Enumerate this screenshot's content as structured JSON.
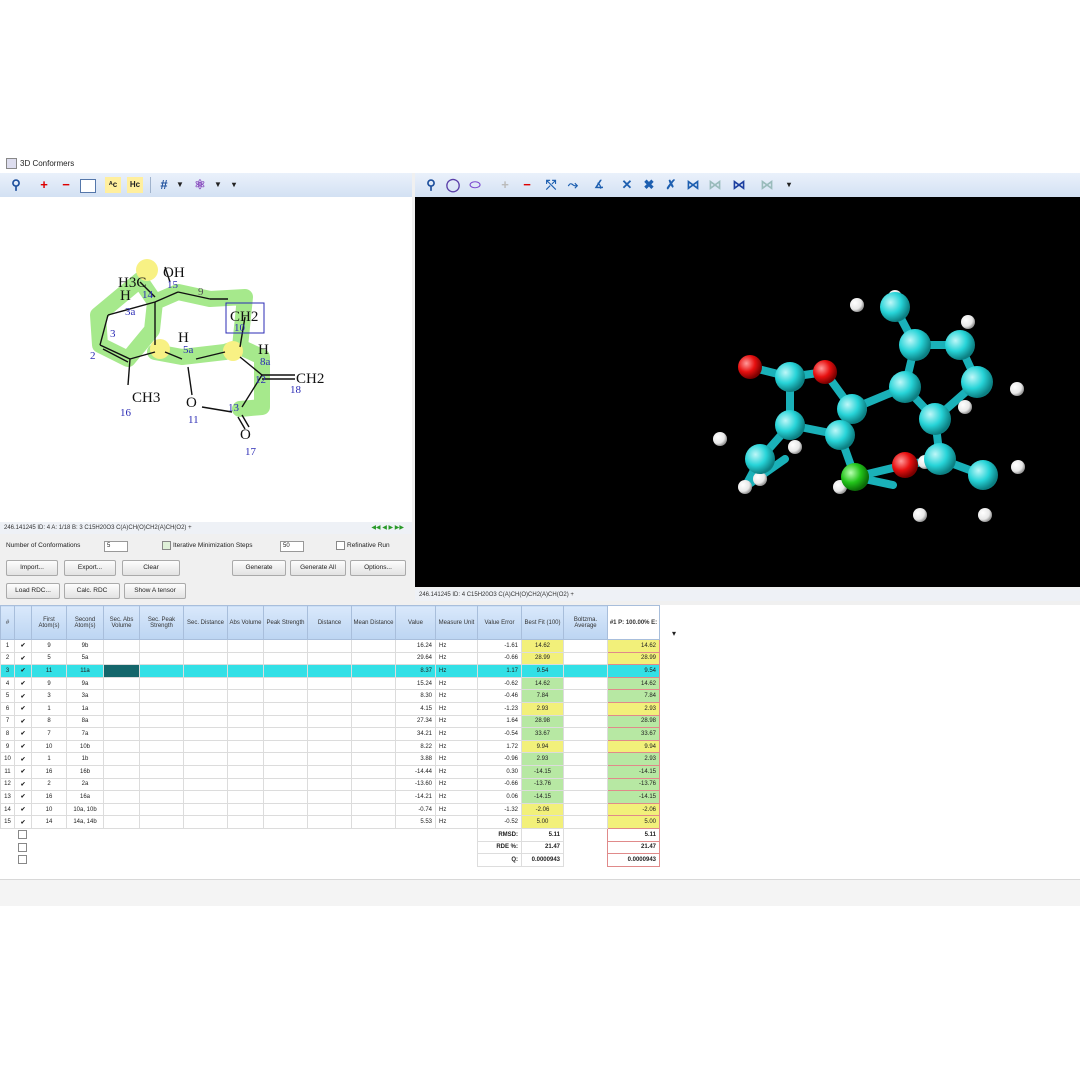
{
  "window": {
    "title": "3D Conformers"
  },
  "toolbar_left": {
    "icons": [
      "zoom-icon",
      "zoom-in-icon",
      "zoom-out-icon",
      "fit-icon",
      "label-icon",
      "label2-icon",
      "grid-icon",
      "dropdown-icon",
      "atom-icon",
      "dropdown-icon",
      "overflow-icon"
    ],
    "plus": "+",
    "minus": "−",
    "hash": "#"
  },
  "toolbar_right": {
    "icons": [
      "zoom-icon",
      "rotate-icon",
      "ellipse-icon",
      "zoom-in-icon",
      "zoom-out-icon",
      "bond-icon",
      "bond2-icon",
      "angle-icon",
      "x-icon",
      "xx-icon",
      "xxx-icon",
      "align-icon",
      "align2-icon",
      "bowtie-icon",
      "bowtie2-icon",
      "overflow-icon"
    ],
    "plus": "+",
    "minus": "−"
  },
  "molecule": {
    "labels": {
      "h3c": "H3C",
      "oh": "OH",
      "h": "H",
      "c14": "14",
      "c15": "15",
      "c9": "9",
      "ch2_10": "CH2",
      "n10": "10",
      "c3a": "3a",
      "c3": "3",
      "c2": "2",
      "h_mid": "H",
      "c5a": "5a",
      "h8": "H",
      "c8a": "8a",
      "ch2_18": "CH2",
      "n18": "18",
      "c12": "12",
      "ch3": "CH3",
      "n16": "16",
      "o": "O",
      "n11": "11",
      "c13": "13",
      "o2": "O",
      "n17": "17"
    }
  },
  "left_info": {
    "text": "246.141245   ID: 4   A: 1/18   B: 3   C15H20O3   C(A)CH(O)CH2(A)CH(O2) +"
  },
  "right_info": {
    "text": "246.141245   ID: 4   C15H20O3   C(A)CH(O)CH2(A)CH(O2) +"
  },
  "controls": {
    "num_conf_label": "Number of Conformations",
    "num_conf_value": "5",
    "iter_label": "Iterative Minimization Steps",
    "iter_value": "50",
    "refinement_label": "Refinative Run",
    "buttons_row1": [
      "Import...",
      "Export...",
      "Clear",
      "Generate",
      "Generate All",
      "Options..."
    ],
    "buttons_row2": [
      "Load RDC...",
      "Calc. RDC",
      "Show A tensor"
    ]
  },
  "grid": {
    "headers": [
      "#",
      "",
      "First Atom(s)",
      "Second Atom(s)",
      "Sec. Abs Volume",
      "Sec. Peak Strength",
      "Sec. Distance",
      "Abs Volume",
      "Peak Strength",
      "Distance",
      "Mean Distance",
      "Value",
      "Measure Unit",
      "Value Error",
      "Best Fit (100)",
      "Boltzma. Average",
      "#1 P: 100.00% E:"
    ],
    "rows": [
      [
        "1",
        "9",
        "9b",
        "16.24",
        "Hz",
        "-1.61",
        "14.62",
        "14.62"
      ],
      [
        "2",
        "5",
        "5a",
        "29.64",
        "Hz",
        "-0.66",
        "28.99",
        "28.99"
      ],
      [
        "3",
        "11",
        "11a",
        "8.37",
        "Hz",
        "1.17",
        "9.54",
        "9.54"
      ],
      [
        "4",
        "9",
        "9a",
        "15.24",
        "Hz",
        "-0.62",
        "14.62",
        "14.62"
      ],
      [
        "5",
        "3",
        "3a",
        "8.30",
        "Hz",
        "-0.46",
        "7.84",
        "7.84"
      ],
      [
        "6",
        "1",
        "1a",
        "4.15",
        "Hz",
        "-1.23",
        "2.93",
        "2.93"
      ],
      [
        "7",
        "8",
        "8a",
        "27.34",
        "Hz",
        "1.64",
        "28.98",
        "28.98"
      ],
      [
        "8",
        "7",
        "7a",
        "34.21",
        "Hz",
        "-0.54",
        "33.67",
        "33.67"
      ],
      [
        "9",
        "10",
        "10b",
        "8.22",
        "Hz",
        "1.72",
        "9.94",
        "9.94"
      ],
      [
        "10",
        "1",
        "1b",
        "3.88",
        "Hz",
        "-0.96",
        "2.93",
        "2.93"
      ],
      [
        "11",
        "16",
        "16b",
        "-14.44",
        "Hz",
        "0.30",
        "-14.15",
        "-14.15"
      ],
      [
        "12",
        "2",
        "2a",
        "-13.60",
        "Hz",
        "-0.66",
        "-13.76",
        "-13.76"
      ],
      [
        "13",
        "16",
        "16a",
        "-14.21",
        "Hz",
        "0.06",
        "-14.15",
        "-14.15"
      ],
      [
        "14",
        "10",
        "10a, 10b",
        "-0.74",
        "Hz",
        "-1.32",
        "-2.06",
        "-2.06"
      ],
      [
        "15",
        "14",
        "14a, 14b",
        "5.53",
        "Hz",
        "-0.52",
        "5.00",
        "5.00"
      ]
    ],
    "fit_colors": [
      "y",
      "y",
      "y",
      "gr",
      "gr",
      "y",
      "gr",
      "gr",
      "y",
      "gr",
      "gr",
      "gr",
      "gr",
      "y",
      "y"
    ],
    "summary": [
      {
        "label": "RMSD:",
        "best": "5.11",
        "conf": "5.11"
      },
      {
        "label": "RDE %:",
        "best": "21.47",
        "conf": "21.47"
      },
      {
        "label": "Q:",
        "best": "0.0000943",
        "conf": "0.0000943"
      }
    ],
    "selected_row": 3
  },
  "colors": {
    "carbon": "#27d4d8",
    "oxygen": "#e81010",
    "hydrogen": "#ffffff",
    "selected": "#1ab1b9",
    "highlight": "#a6e98c"
  }
}
